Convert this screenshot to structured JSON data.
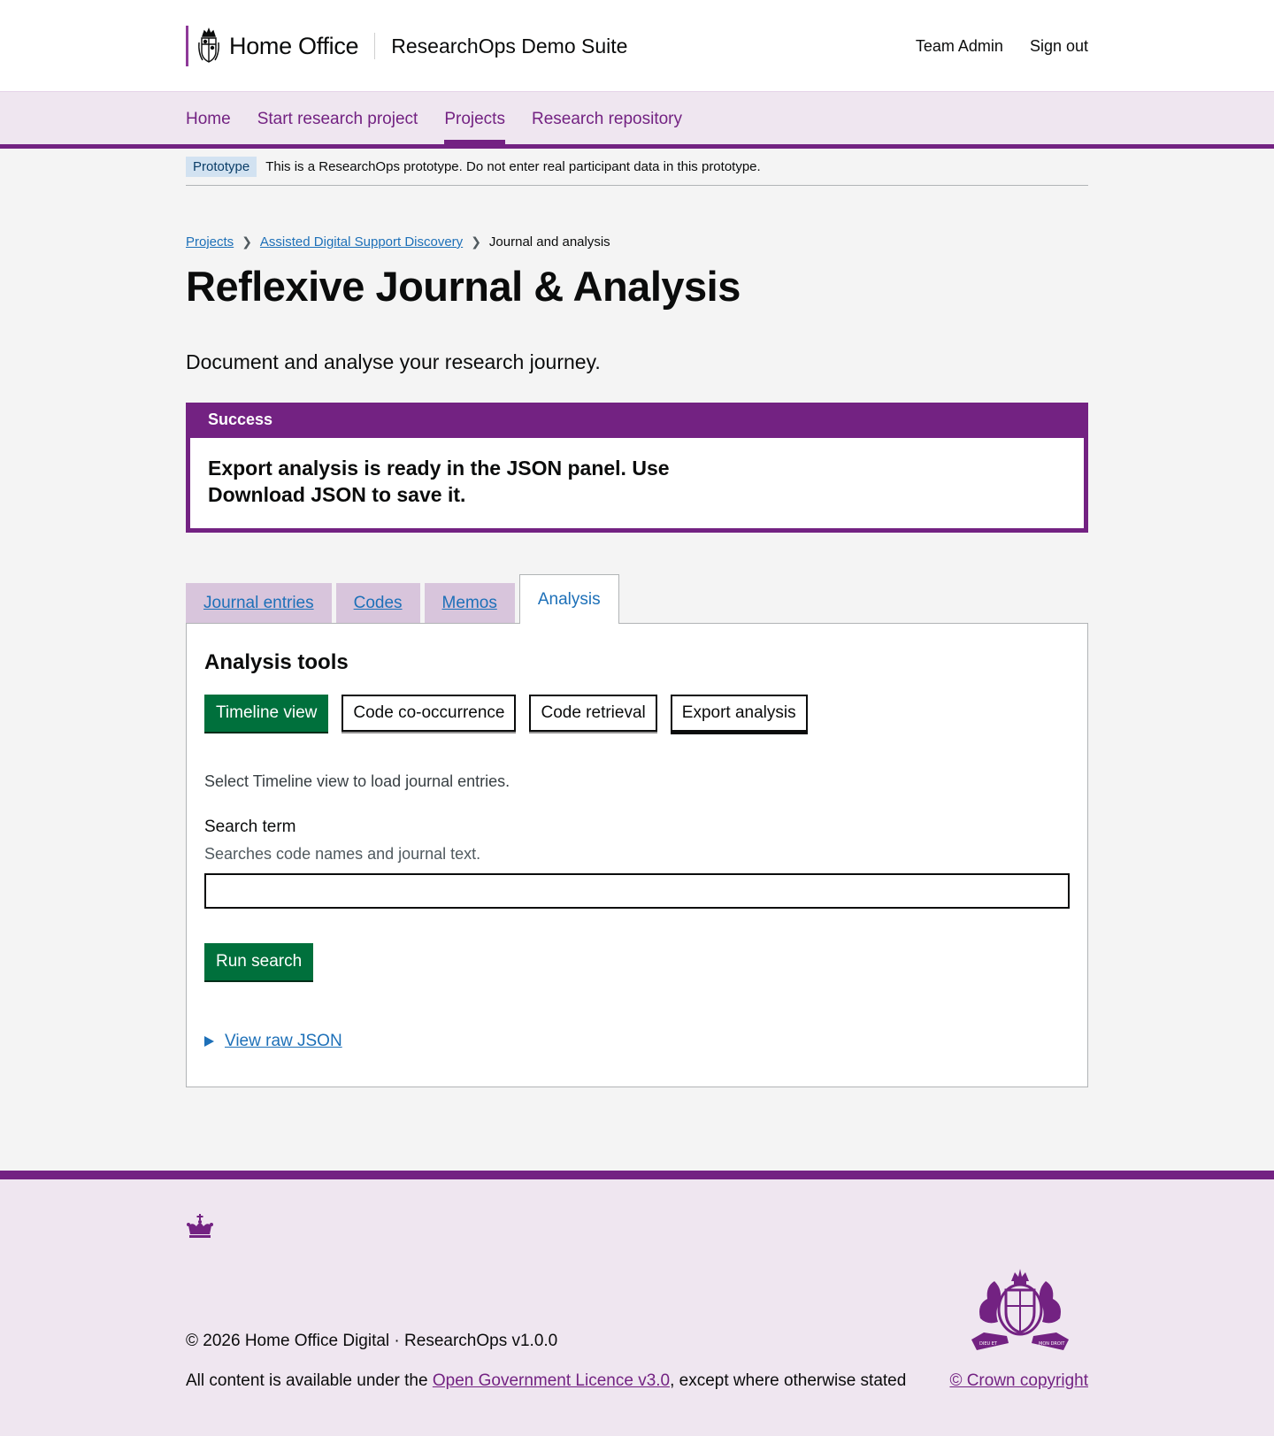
{
  "header": {
    "org_name": "Home Office",
    "service_name": "ResearchOps Demo Suite",
    "links": [
      "Team Admin",
      "Sign out"
    ]
  },
  "nav": {
    "items": [
      "Home",
      "Start research project",
      "Projects",
      "Research repository"
    ],
    "active": "Projects"
  },
  "phase_banner": {
    "tag": "Prototype",
    "text": "This is a ResearchOps prototype. Do not enter real participant data in this prototype."
  },
  "breadcrumbs": [
    "Projects",
    "Assisted Digital Support Discovery",
    "Journal and analysis"
  ],
  "page": {
    "title": "Reflexive Journal & Analysis",
    "lead": "Document and analyse your research journey."
  },
  "notification": {
    "title": "Success",
    "message": "Export analysis is ready in the JSON panel. Use Download JSON to save it."
  },
  "tabs": {
    "items": [
      "Journal entries",
      "Codes",
      "Memos",
      "Analysis"
    ],
    "active": "Analysis"
  },
  "analysis": {
    "heading": "Analysis tools",
    "tools": [
      "Timeline view",
      "Code co-occurrence",
      "Code retrieval",
      "Export analysis"
    ],
    "timeline_hint": "Select Timeline view to load journal entries.",
    "search_label": "Search term",
    "search_hint": "Searches code names and journal text.",
    "search_value": "",
    "run_button": "Run search",
    "details_summary": "View raw JSON"
  },
  "footer": {
    "copyright": "© 2026 Home Office Digital · ResearchOps v1.0.0",
    "licence_prefix": "All content is available under the ",
    "licence_link": "Open Government Licence v3.0",
    "licence_suffix": ", except where otherwise stated",
    "crown_copyright": "© Crown copyright",
    "crest_motto_left": "DIEU ET",
    "crest_motto_right": "MON DROIT"
  },
  "colors": {
    "brand_purple": "#732282",
    "nav_background": "#efe6f0",
    "button_green": "#00703c",
    "link_blue": "#1d70b8"
  }
}
